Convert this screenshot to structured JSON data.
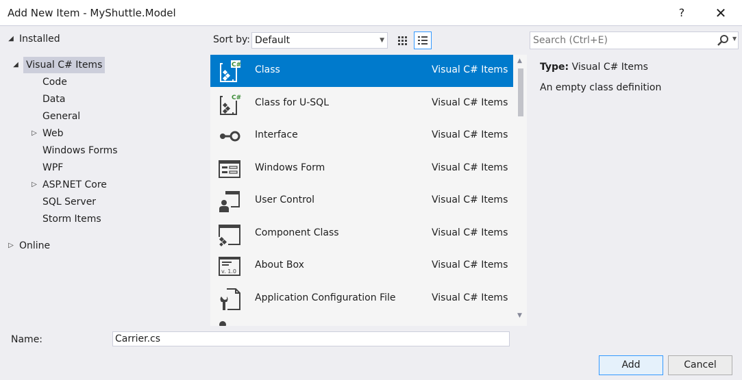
{
  "window": {
    "title": "Add New Item - MyShuttle.Model",
    "help_label": "?",
    "close_label": "✕"
  },
  "tree": {
    "installed": "Installed",
    "visual_csharp_items": "Visual C# Items",
    "children": [
      "Code",
      "Data",
      "General",
      "Web",
      "Windows Forms",
      "WPF",
      "ASP.NET Core",
      "SQL Server",
      "Storm Items"
    ],
    "online": "Online"
  },
  "toolbar": {
    "sort_label": "Sort by:",
    "sort_value": "Default"
  },
  "items": [
    {
      "name": "Class",
      "category": "Visual C# Items",
      "icon": "class-icon"
    },
    {
      "name": "Class for U-SQL",
      "category": "Visual C# Items",
      "icon": "usql-class-icon"
    },
    {
      "name": "Interface",
      "category": "Visual C# Items",
      "icon": "interface-icon"
    },
    {
      "name": "Windows Form",
      "category": "Visual C# Items",
      "icon": "windows-form-icon"
    },
    {
      "name": "User Control",
      "category": "Visual C# Items",
      "icon": "user-control-icon"
    },
    {
      "name": "Component Class",
      "category": "Visual C# Items",
      "icon": "component-class-icon"
    },
    {
      "name": "About Box",
      "category": "Visual C# Items",
      "icon": "about-box-icon"
    },
    {
      "name": "Application Configuration File",
      "category": "Visual C# Items",
      "icon": "config-file-icon"
    }
  ],
  "search": {
    "placeholder": "Search (Ctrl+E)"
  },
  "details": {
    "type_label": "Type:",
    "type_value": "Visual C# Items",
    "description": "An empty class definition",
    "about_box_version": "v. 1.0"
  },
  "footer": {
    "name_label": "Name:",
    "name_value": "Carrier.cs",
    "add_label": "Add",
    "cancel_label": "Cancel"
  },
  "colors": {
    "accent": "#007acc",
    "tree_selection": "#cccedb",
    "background": "#eeeef2"
  }
}
